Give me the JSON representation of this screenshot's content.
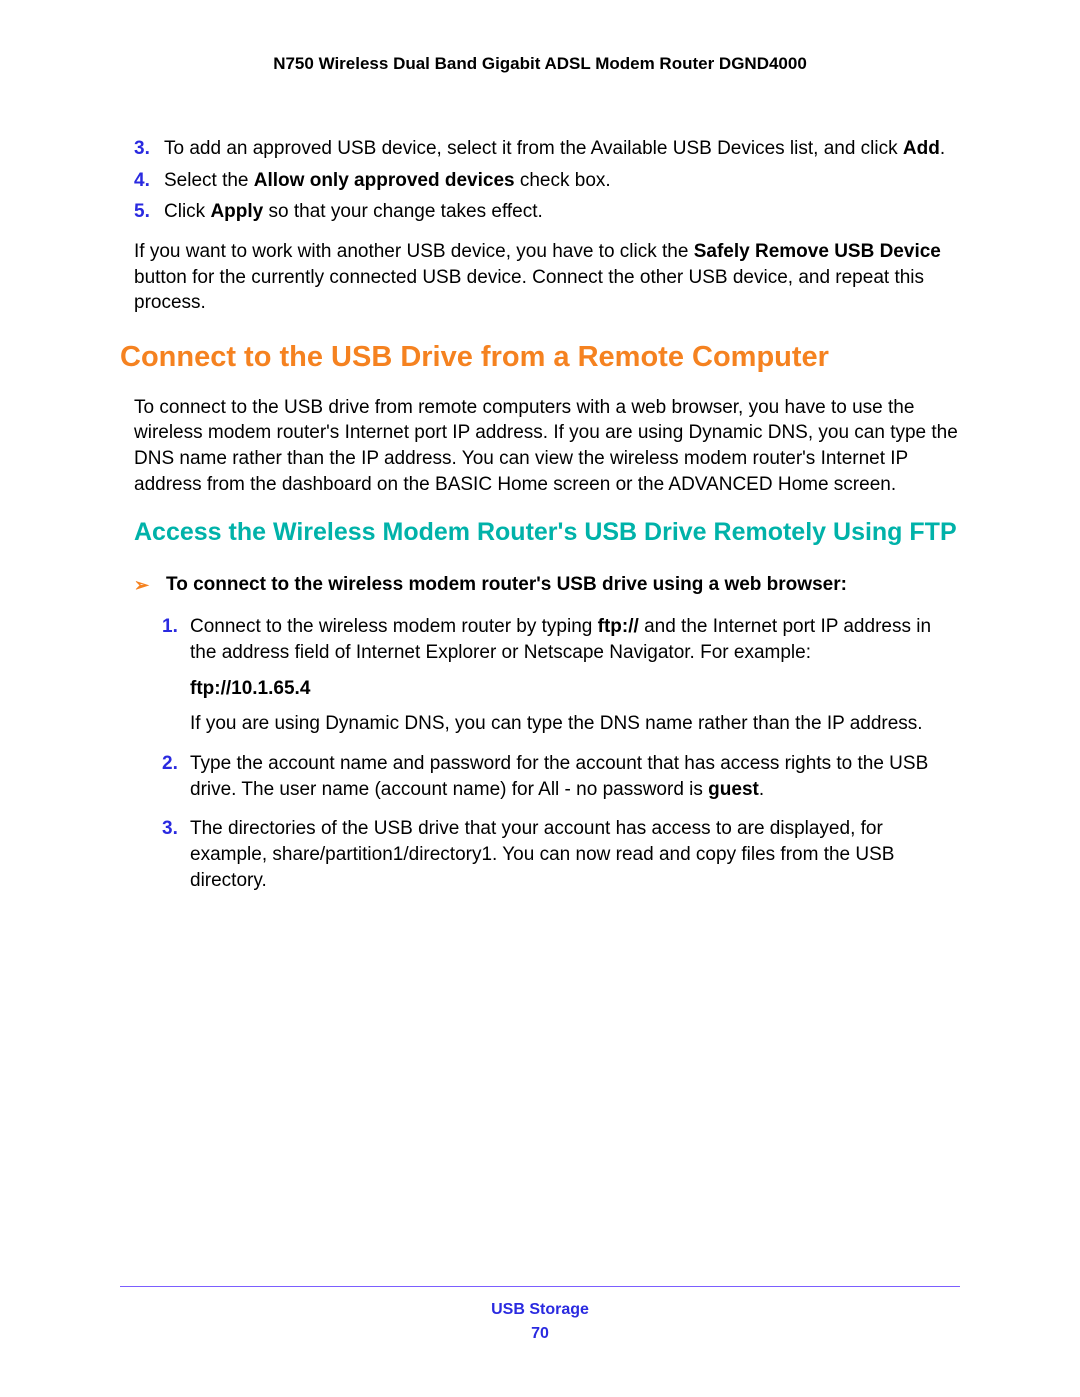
{
  "header": "N750 Wireless Dual Band Gigabit ADSL Modem Router DGND4000",
  "steps_a": {
    "n3": "3.",
    "t3a": "To add an approved USB device, select it from the Available USB Devices list, and click ",
    "t3b": "Add",
    "t3c": ".",
    "n4": "4.",
    "t4a": "Select the ",
    "t4b": "Allow only approved devices",
    "t4c": " check box.",
    "n5": "5.",
    "t5a": "Click ",
    "t5b": "Apply",
    "t5c": " so that your change takes effect."
  },
  "para1a": "If you want to work with another USB device, you have to click the ",
  "para1b": "Safely Remove USB Device",
  "para1c": " button for the currently connected USB device. Connect the other USB device, and repeat this process.",
  "h_orange": "Connect to the USB Drive from a Remote Computer",
  "para2": "To connect to the USB drive from remote computers with a web browser, you have to use the wireless modem router's Internet port IP address. If you are using Dynamic DNS, you can type the DNS name rather than the IP address. You can view the wireless modem router's Internet IP address from the dashboard on the BASIC Home screen or the ADVANCED Home screen.",
  "h_teal": "Access the Wireless Modem Router's USB Drive Remotely Using FTP",
  "arrow": "➢",
  "task_lead": "To connect to the wireless modem router's USB drive using a web browser:",
  "steps_b": {
    "n1": "1.",
    "t1a": "Connect to the wireless modem router by typing ",
    "t1b": "ftp://",
    "t1c": " and the Internet port IP address in the address field of Internet Explorer or Netscape Navigator. For example:",
    "t1d": "ftp://10.1.65.4",
    "t1e": "If you are using Dynamic DNS, you can type the DNS name rather than the IP address.",
    "n2": "2.",
    "t2a": "Type the account name and password for the account that has access rights to the USB drive. The user name (account name) for All - no password is ",
    "t2b": "guest",
    "t2c": ".",
    "n3": "3.",
    "t3": "The directories of the USB drive that your account has access to are displayed, for example, share/partition1/directory1. You can now read and copy files from the USB directory."
  },
  "footer1": "USB Storage",
  "footer2": "70"
}
